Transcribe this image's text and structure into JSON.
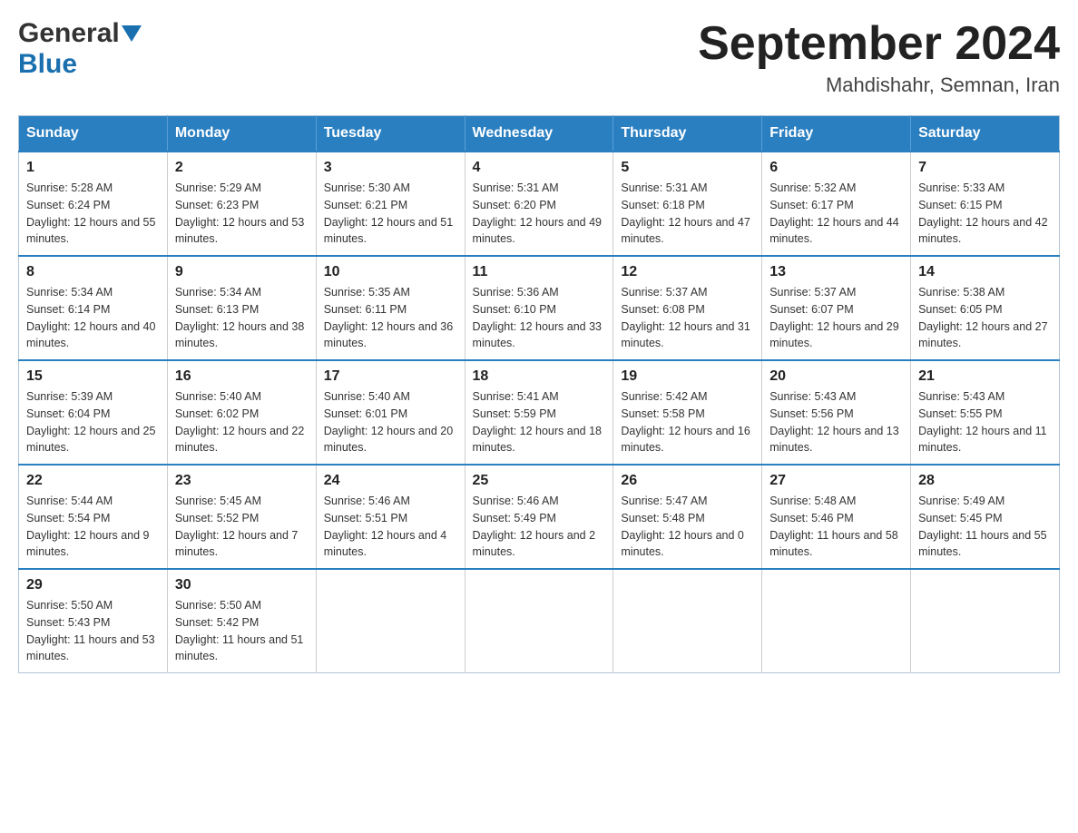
{
  "logo": {
    "general": "General",
    "blue": "Blue"
  },
  "header": {
    "title": "September 2024",
    "subtitle": "Mahdishahr, Semnan, Iran"
  },
  "weekdays": [
    "Sunday",
    "Monday",
    "Tuesday",
    "Wednesday",
    "Thursday",
    "Friday",
    "Saturday"
  ],
  "weeks": [
    [
      {
        "day": "1",
        "sunrise": "Sunrise: 5:28 AM",
        "sunset": "Sunset: 6:24 PM",
        "daylight": "Daylight: 12 hours and 55 minutes."
      },
      {
        "day": "2",
        "sunrise": "Sunrise: 5:29 AM",
        "sunset": "Sunset: 6:23 PM",
        "daylight": "Daylight: 12 hours and 53 minutes."
      },
      {
        "day": "3",
        "sunrise": "Sunrise: 5:30 AM",
        "sunset": "Sunset: 6:21 PM",
        "daylight": "Daylight: 12 hours and 51 minutes."
      },
      {
        "day": "4",
        "sunrise": "Sunrise: 5:31 AM",
        "sunset": "Sunset: 6:20 PM",
        "daylight": "Daylight: 12 hours and 49 minutes."
      },
      {
        "day": "5",
        "sunrise": "Sunrise: 5:31 AM",
        "sunset": "Sunset: 6:18 PM",
        "daylight": "Daylight: 12 hours and 47 minutes."
      },
      {
        "day": "6",
        "sunrise": "Sunrise: 5:32 AM",
        "sunset": "Sunset: 6:17 PM",
        "daylight": "Daylight: 12 hours and 44 minutes."
      },
      {
        "day": "7",
        "sunrise": "Sunrise: 5:33 AM",
        "sunset": "Sunset: 6:15 PM",
        "daylight": "Daylight: 12 hours and 42 minutes."
      }
    ],
    [
      {
        "day": "8",
        "sunrise": "Sunrise: 5:34 AM",
        "sunset": "Sunset: 6:14 PM",
        "daylight": "Daylight: 12 hours and 40 minutes."
      },
      {
        "day": "9",
        "sunrise": "Sunrise: 5:34 AM",
        "sunset": "Sunset: 6:13 PM",
        "daylight": "Daylight: 12 hours and 38 minutes."
      },
      {
        "day": "10",
        "sunrise": "Sunrise: 5:35 AM",
        "sunset": "Sunset: 6:11 PM",
        "daylight": "Daylight: 12 hours and 36 minutes."
      },
      {
        "day": "11",
        "sunrise": "Sunrise: 5:36 AM",
        "sunset": "Sunset: 6:10 PM",
        "daylight": "Daylight: 12 hours and 33 minutes."
      },
      {
        "day": "12",
        "sunrise": "Sunrise: 5:37 AM",
        "sunset": "Sunset: 6:08 PM",
        "daylight": "Daylight: 12 hours and 31 minutes."
      },
      {
        "day": "13",
        "sunrise": "Sunrise: 5:37 AM",
        "sunset": "Sunset: 6:07 PM",
        "daylight": "Daylight: 12 hours and 29 minutes."
      },
      {
        "day": "14",
        "sunrise": "Sunrise: 5:38 AM",
        "sunset": "Sunset: 6:05 PM",
        "daylight": "Daylight: 12 hours and 27 minutes."
      }
    ],
    [
      {
        "day": "15",
        "sunrise": "Sunrise: 5:39 AM",
        "sunset": "Sunset: 6:04 PM",
        "daylight": "Daylight: 12 hours and 25 minutes."
      },
      {
        "day": "16",
        "sunrise": "Sunrise: 5:40 AM",
        "sunset": "Sunset: 6:02 PM",
        "daylight": "Daylight: 12 hours and 22 minutes."
      },
      {
        "day": "17",
        "sunrise": "Sunrise: 5:40 AM",
        "sunset": "Sunset: 6:01 PM",
        "daylight": "Daylight: 12 hours and 20 minutes."
      },
      {
        "day": "18",
        "sunrise": "Sunrise: 5:41 AM",
        "sunset": "Sunset: 5:59 PM",
        "daylight": "Daylight: 12 hours and 18 minutes."
      },
      {
        "day": "19",
        "sunrise": "Sunrise: 5:42 AM",
        "sunset": "Sunset: 5:58 PM",
        "daylight": "Daylight: 12 hours and 16 minutes."
      },
      {
        "day": "20",
        "sunrise": "Sunrise: 5:43 AM",
        "sunset": "Sunset: 5:56 PM",
        "daylight": "Daylight: 12 hours and 13 minutes."
      },
      {
        "day": "21",
        "sunrise": "Sunrise: 5:43 AM",
        "sunset": "Sunset: 5:55 PM",
        "daylight": "Daylight: 12 hours and 11 minutes."
      }
    ],
    [
      {
        "day": "22",
        "sunrise": "Sunrise: 5:44 AM",
        "sunset": "Sunset: 5:54 PM",
        "daylight": "Daylight: 12 hours and 9 minutes."
      },
      {
        "day": "23",
        "sunrise": "Sunrise: 5:45 AM",
        "sunset": "Sunset: 5:52 PM",
        "daylight": "Daylight: 12 hours and 7 minutes."
      },
      {
        "day": "24",
        "sunrise": "Sunrise: 5:46 AM",
        "sunset": "Sunset: 5:51 PM",
        "daylight": "Daylight: 12 hours and 4 minutes."
      },
      {
        "day": "25",
        "sunrise": "Sunrise: 5:46 AM",
        "sunset": "Sunset: 5:49 PM",
        "daylight": "Daylight: 12 hours and 2 minutes."
      },
      {
        "day": "26",
        "sunrise": "Sunrise: 5:47 AM",
        "sunset": "Sunset: 5:48 PM",
        "daylight": "Daylight: 12 hours and 0 minutes."
      },
      {
        "day": "27",
        "sunrise": "Sunrise: 5:48 AM",
        "sunset": "Sunset: 5:46 PM",
        "daylight": "Daylight: 11 hours and 58 minutes."
      },
      {
        "day": "28",
        "sunrise": "Sunrise: 5:49 AM",
        "sunset": "Sunset: 5:45 PM",
        "daylight": "Daylight: 11 hours and 55 minutes."
      }
    ],
    [
      {
        "day": "29",
        "sunrise": "Sunrise: 5:50 AM",
        "sunset": "Sunset: 5:43 PM",
        "daylight": "Daylight: 11 hours and 53 minutes."
      },
      {
        "day": "30",
        "sunrise": "Sunrise: 5:50 AM",
        "sunset": "Sunset: 5:42 PM",
        "daylight": "Daylight: 11 hours and 51 minutes."
      },
      null,
      null,
      null,
      null,
      null
    ]
  ]
}
